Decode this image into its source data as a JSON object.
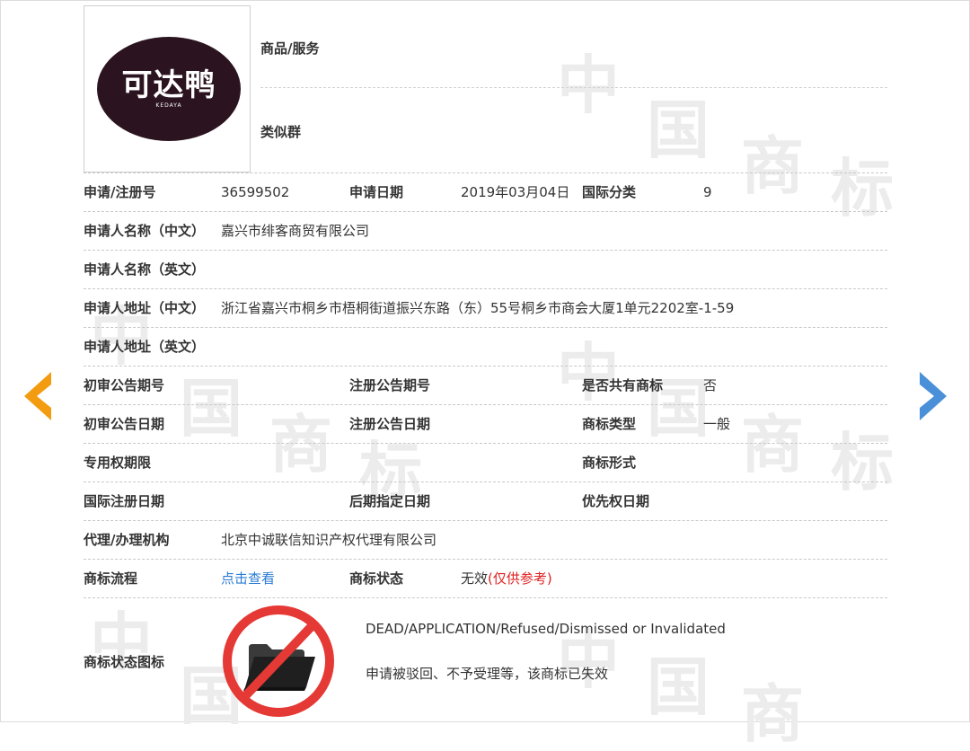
{
  "watermark": {
    "text1": "中",
    "text2": "国",
    "text3": "商",
    "text4": "标"
  },
  "logo": {
    "text": "可达鸭",
    "sub": "KEDAYA"
  },
  "top": {
    "goods_label": "商品/服务",
    "similar_label": "类似群"
  },
  "fields": {
    "reg_no_label": "申请/注册号",
    "reg_no": "36599502",
    "apply_date_label": "申请日期",
    "apply_date": "2019年03月04日",
    "intl_class_label": "国际分类",
    "intl_class": "9",
    "applicant_cn_label": "申请人名称（中文）",
    "applicant_cn": "嘉兴市绯客商贸有限公司",
    "applicant_en_label": "申请人名称（英文）",
    "address_cn_label": "申请人地址（中文）",
    "address_cn": "浙江省嘉兴市桐乡市梧桐街道振兴东路（东）55号桐乡市商会大厦1单元2202室-1-59",
    "address_en_label": "申请人地址（英文）",
    "prelim_no_label": "初审公告期号",
    "reg_pub_no_label": "注册公告期号",
    "shared_label": "是否共有商标",
    "shared": "否",
    "prelim_date_label": "初审公告日期",
    "reg_pub_date_label": "注册公告日期",
    "tm_type_label": "商标类型",
    "tm_type": "一般",
    "exclusive_label": "专用权期限",
    "tm_form_label": "商标形式",
    "intl_reg_date_label": "国际注册日期",
    "later_date_label": "后期指定日期",
    "priority_date_label": "优先权日期",
    "agent_label": "代理/办理机构",
    "agent": "北京中诚联信知识产权代理有限公司",
    "process_label": "商标流程",
    "process_link": "点击查看",
    "status_label": "商标状态",
    "status": "无效",
    "status_note": "(仅供参考)",
    "status_icon_label": "商标状态图标",
    "status_en": "DEAD/APPLICATION/Refused/Dismissed or Invalidated",
    "status_cn": "申请被驳回、不予受理等，该商标已失效"
  },
  "colors": {
    "prev_arrow": "#f39c12",
    "next_arrow": "#4a90d9",
    "status_ring": "#e53935",
    "link": "#2a7bd4"
  }
}
